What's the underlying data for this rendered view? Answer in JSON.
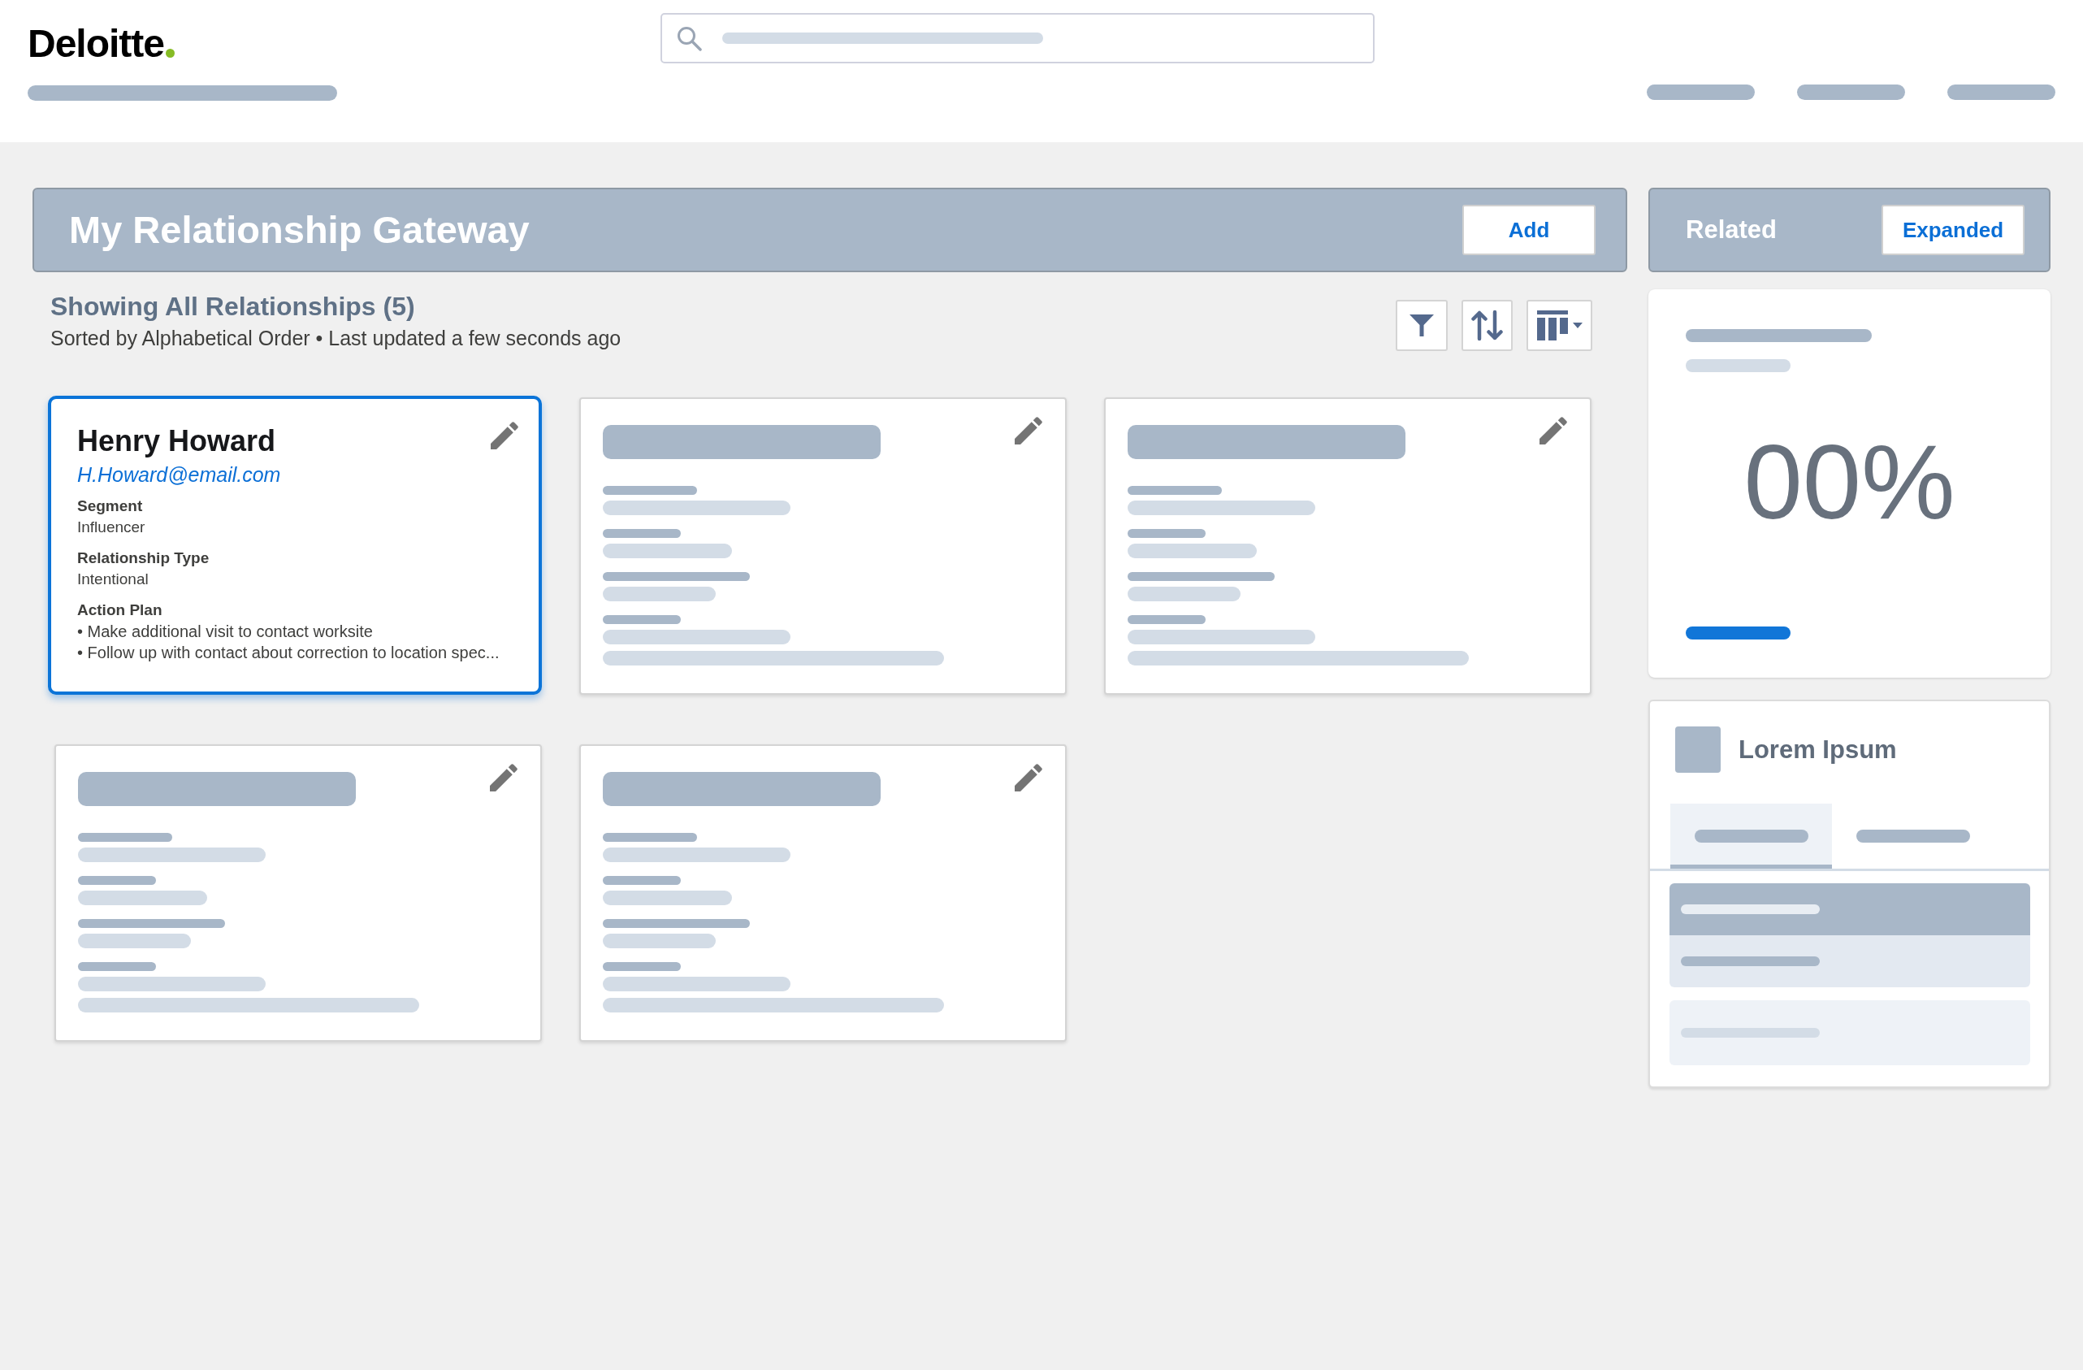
{
  "header": {
    "logo": "Deloitte"
  },
  "gateway": {
    "title": "My Relationship Gateway",
    "add_button": "Add",
    "summary": "Showing All Relationships (5)",
    "subtitle": "Sorted by Alphabetical Order • Last updated a few seconds ago",
    "relationships": [
      {
        "kind": "contact",
        "selected": true,
        "name": "Henry Howard",
        "email": "H.Howard@email.com",
        "fields": [
          {
            "label": "Segment",
            "value": "Influencer"
          },
          {
            "label": "Relationship Type",
            "value": "Intentional"
          },
          {
            "label": "Action Plan",
            "bullets": [
              "• Make additional visit to contact worksite",
              "• Follow up with contact about correction to location spec..."
            ]
          }
        ]
      },
      {
        "kind": "placeholder",
        "selected": false
      },
      {
        "kind": "placeholder",
        "selected": false
      },
      {
        "kind": "placeholder",
        "selected": false
      },
      {
        "kind": "placeholder",
        "selected": false
      }
    ]
  },
  "related": {
    "title": "Related",
    "view_button": "Expanded",
    "metric": {
      "value": "00%"
    },
    "lorem_panel": {
      "title": "Lorem Ipsum",
      "tabs": [
        {
          "selected": true
        },
        {
          "selected": false
        }
      ]
    }
  }
}
